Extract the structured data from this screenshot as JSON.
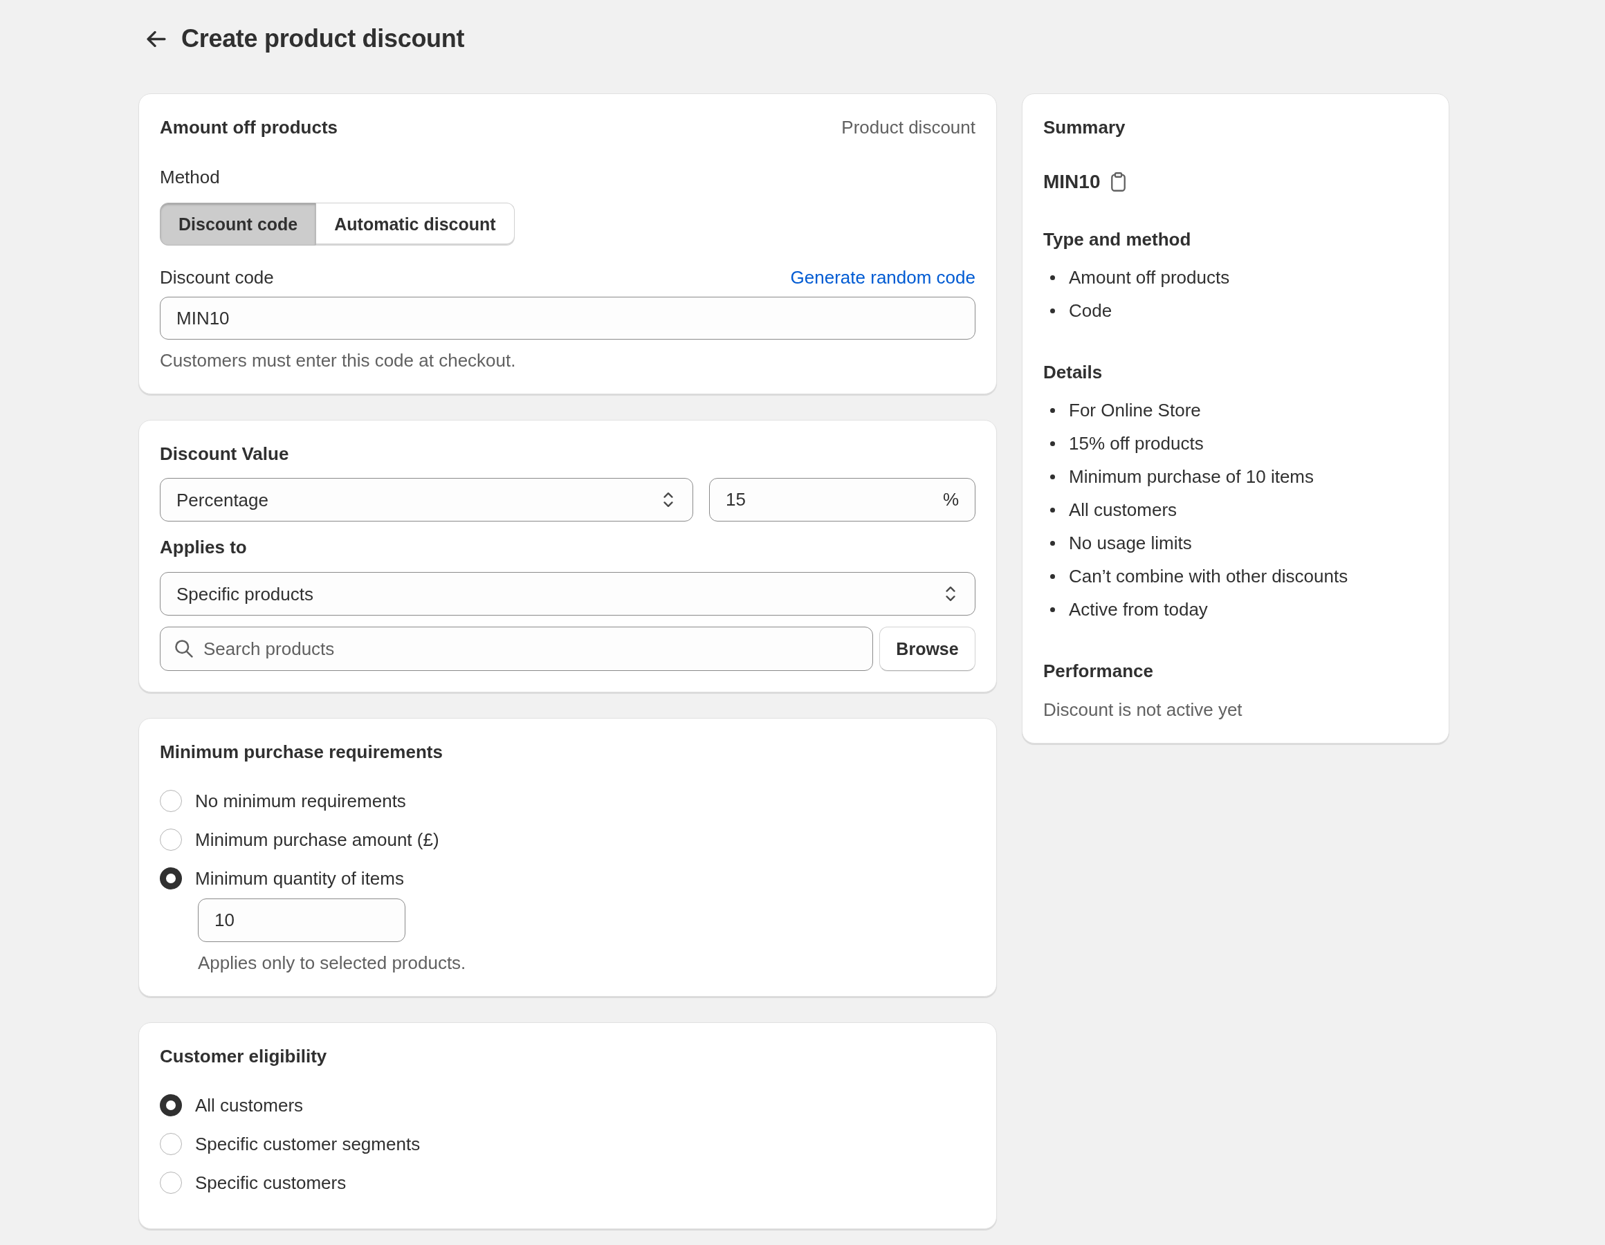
{
  "page": {
    "title": "Create product discount"
  },
  "method_card": {
    "title": "Amount off products",
    "discount_type": "Product discount",
    "method_label": "Method",
    "method_options": [
      {
        "label": "Discount code",
        "selected": true
      },
      {
        "label": "Automatic discount",
        "selected": false
      }
    ],
    "code_field": {
      "label": "Discount code",
      "action_link": "Generate random code",
      "value": "MIN10",
      "help_text": "Customers must enter this code at checkout."
    }
  },
  "value_card": {
    "title": "Discount Value",
    "value_type": {
      "value": "Percentage"
    },
    "amount": {
      "value": "15",
      "suffix": "%"
    },
    "applies_to_label": "Applies to",
    "applies_to": {
      "value": "Specific products"
    },
    "product_search": {
      "placeholder": "Search products"
    },
    "browse_button": "Browse"
  },
  "minimum_requirements_card": {
    "title": "Minimum purchase requirements",
    "options": [
      {
        "label": "No minimum requirements",
        "selected": false
      },
      {
        "label": "Minimum purchase amount (£)",
        "selected": false
      },
      {
        "label": "Minimum quantity of items",
        "selected": true,
        "quantity": {
          "value": "10",
          "help_text": "Applies only to selected products."
        }
      }
    ]
  },
  "customer_eligibility_card": {
    "title": "Customer eligibility",
    "options": [
      {
        "label": "All customers",
        "selected": true
      },
      {
        "label": "Specific customer segments",
        "selected": false
      },
      {
        "label": "Specific customers",
        "selected": false
      }
    ]
  },
  "summary": {
    "title": "Summary",
    "code": "MIN10",
    "sections": [
      {
        "title": "Type and method",
        "items": [
          "Amount off products",
          "Code"
        ]
      },
      {
        "title": "Details",
        "items": [
          "For Online Store",
          "15% off products",
          "Minimum purchase of 10 items",
          "All customers",
          "No usage limits",
          "Can’t combine with other discounts",
          "Active from today"
        ]
      }
    ],
    "performance": {
      "title": "Performance",
      "text": "Discount is not active yet"
    }
  }
}
